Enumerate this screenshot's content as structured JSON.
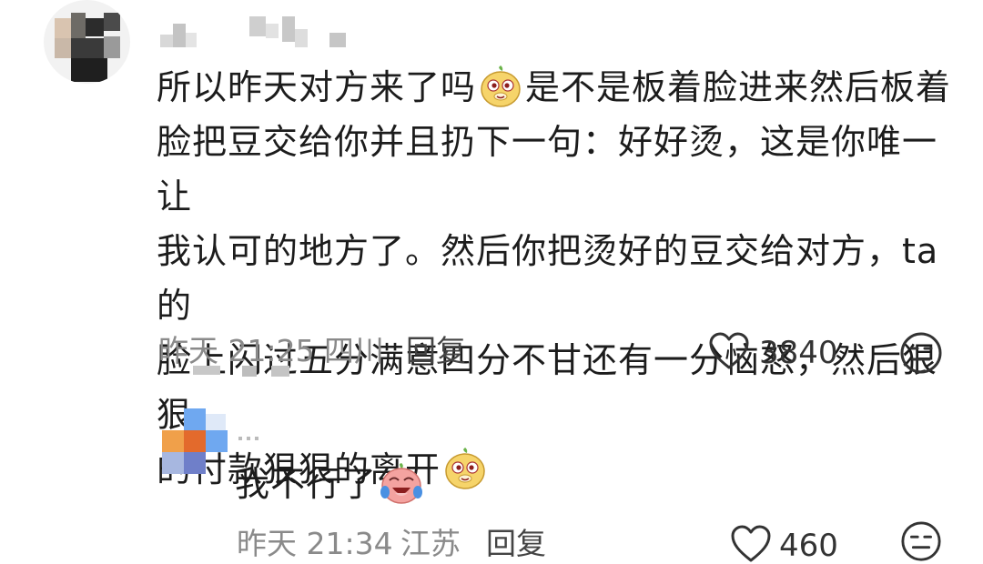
{
  "comment": {
    "text_lines": [
      [
        "所以昨天对方来了吗",
        "是不是板着脸进来然后板着"
      ],
      [
        "脸把豆交给你并且扔下一句：好好烫，这是你唯一让"
      ],
      [
        "我认可的地方了。然后你把烫好的豆交给对方，ta的"
      ],
      [
        "脸上闪过五分满意四分不甘还有一分恼怒，然后狠狠"
      ],
      [
        "的付款狠狠的离开"
      ]
    ],
    "line1_a": "所以昨天对方来了吗",
    "line1_b": "是不是板着脸进来然后板着",
    "line2": "脸把豆交给你并且扔下一句：好好烫，这是你唯一让",
    "line3": "我认可的地方了。然后你把烫好的豆交给对方，ta的",
    "line4": "脸上闪过五分满意四分不甘还有一分恼怒，然后狠狠",
    "line5": "的付款狠狠的离开",
    "emoji_icon": "smirk-dog-emoji-icon",
    "time": "昨天 21:25",
    "location": "四川",
    "reply_label": "回复",
    "likes": "3840"
  },
  "reply": {
    "text": "我不行了",
    "emoji_icon": "crying-laughing-emoji-icon",
    "time": "昨天 21:34",
    "location": "江苏",
    "reply_label": "回复",
    "likes": "460"
  },
  "colors": {
    "text": "#1c1c1c",
    "meta": "#8a8a8a",
    "emoji_yellow": "#f6d46a",
    "emoji_pink": "#f4a3a0"
  }
}
